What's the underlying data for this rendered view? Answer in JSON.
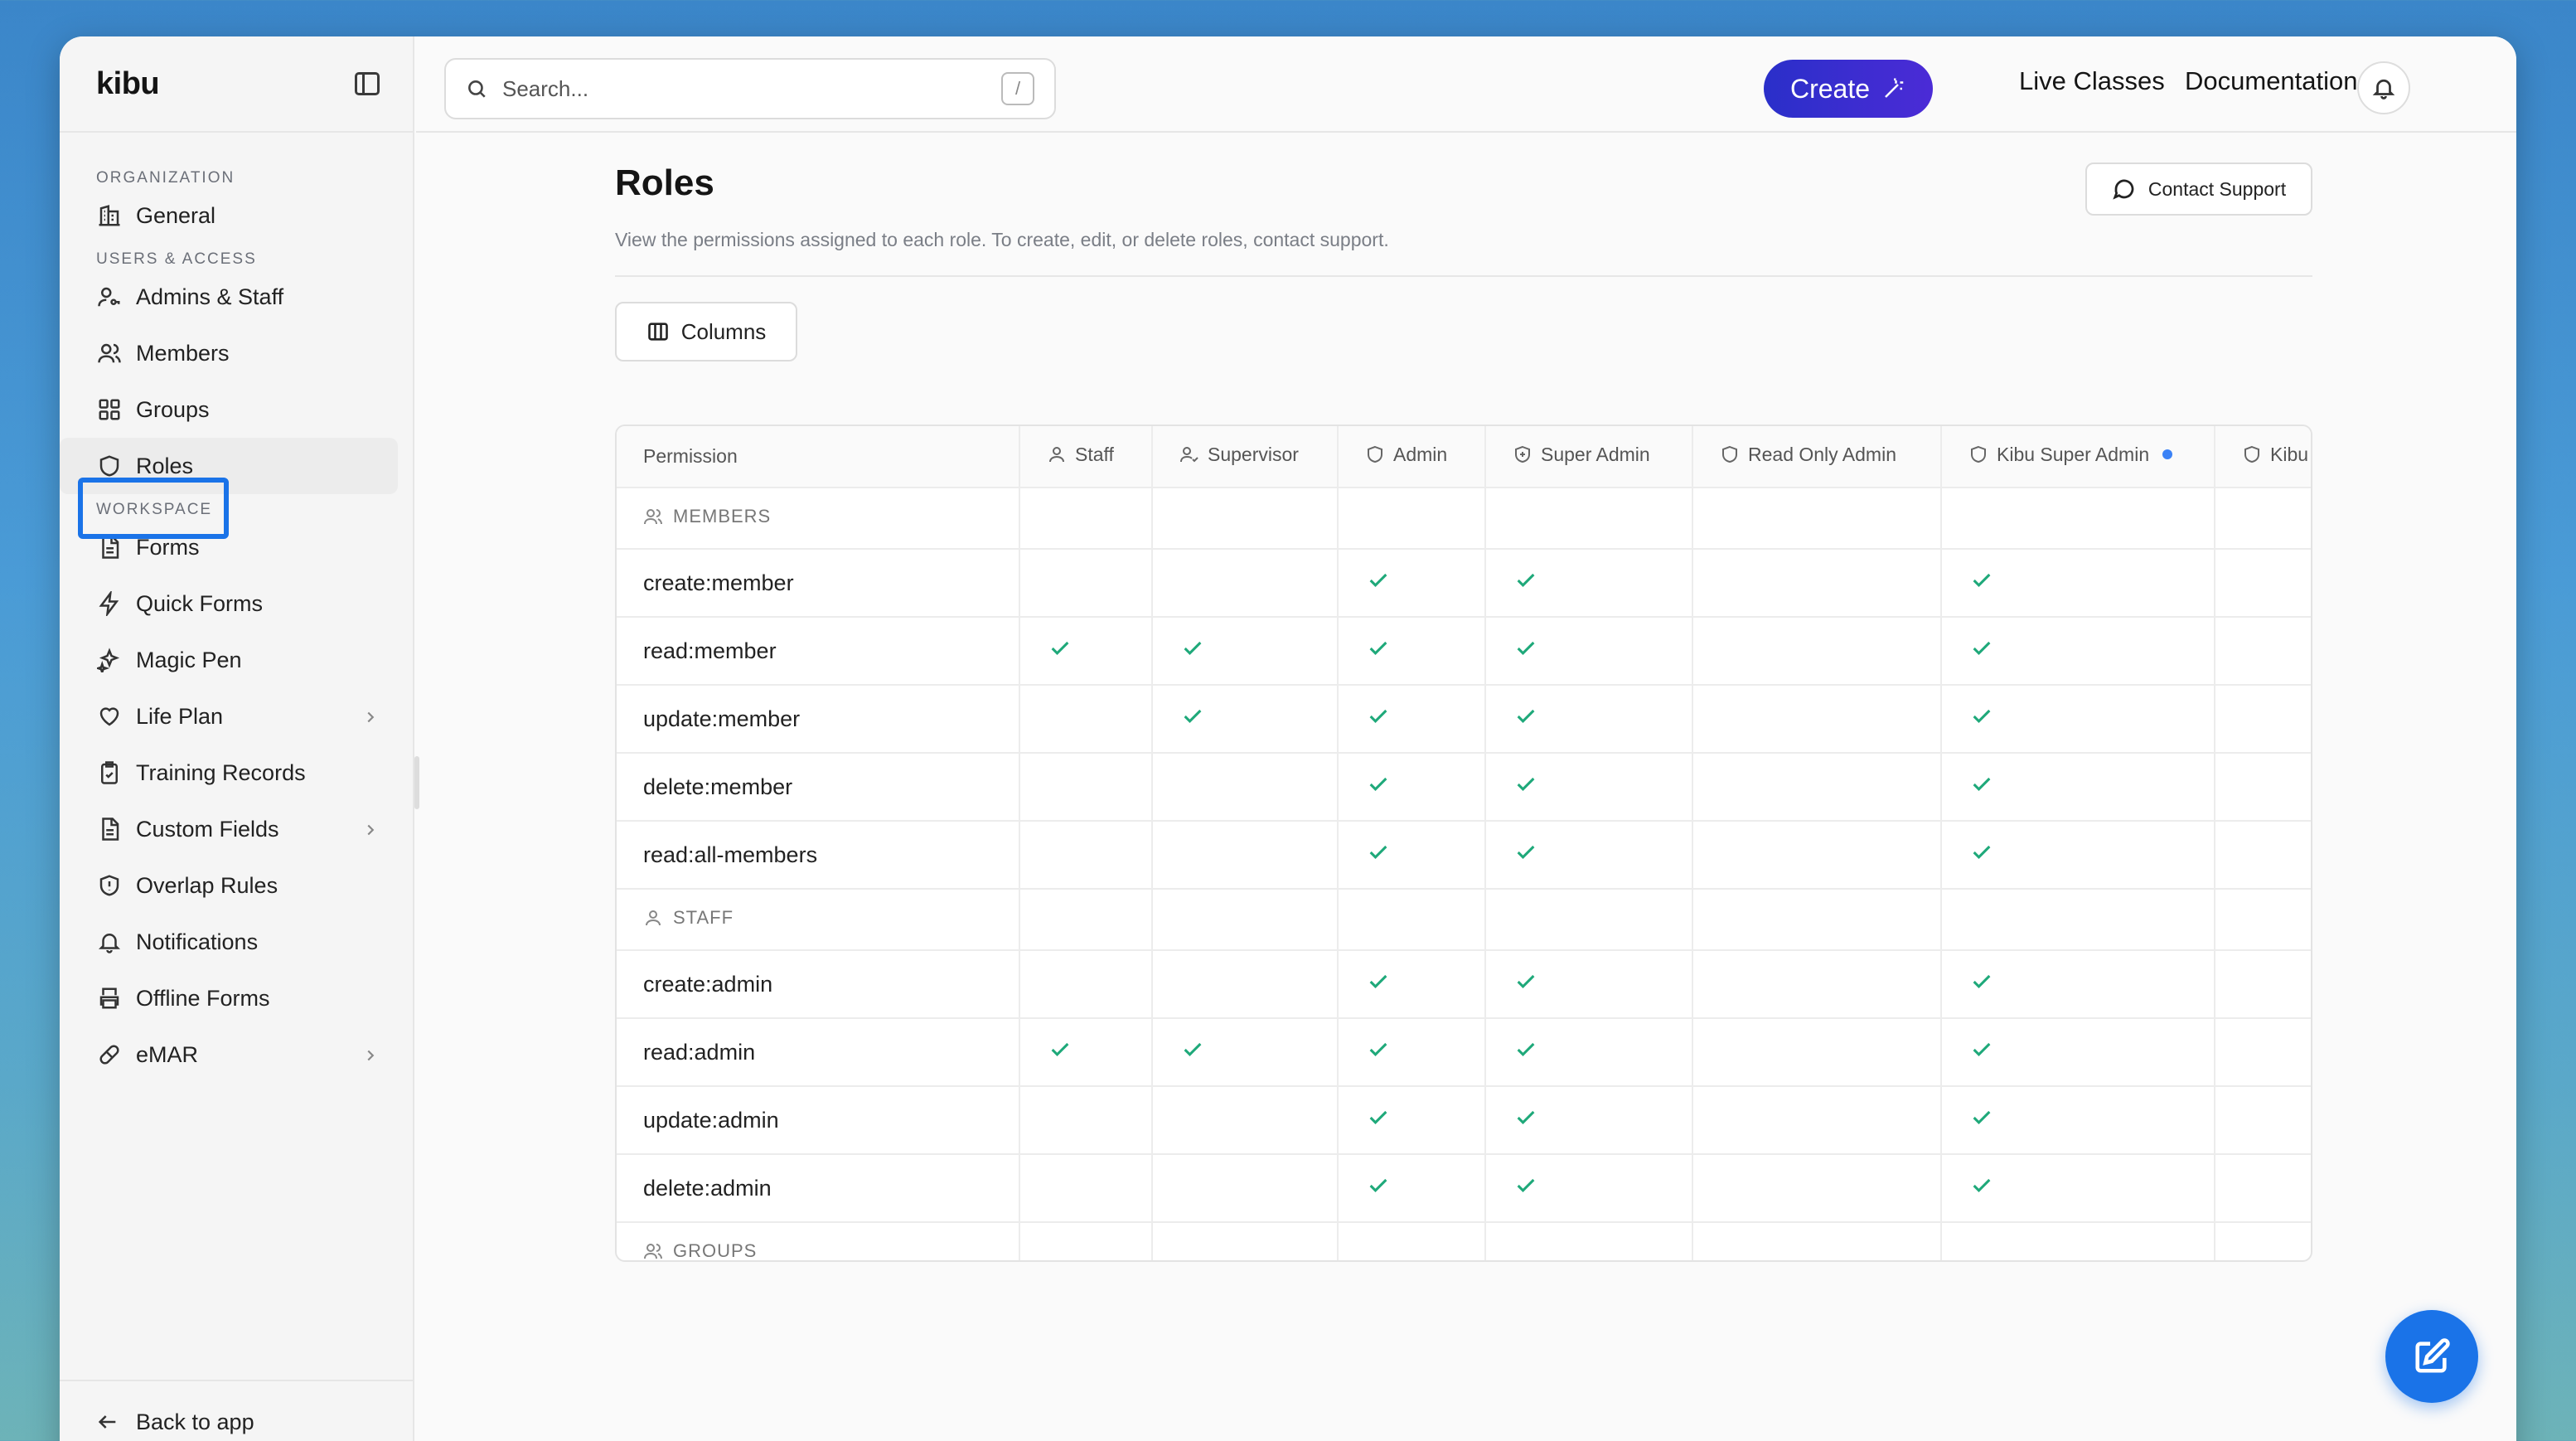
{
  "app": {
    "logo": "kibu"
  },
  "sidebar": {
    "sections": [
      {
        "label": "ORGANIZATION",
        "items": [
          {
            "label": "General",
            "icon": "building-icon"
          }
        ]
      },
      {
        "label": "USERS & ACCESS",
        "items": [
          {
            "label": "Admins & Staff",
            "icon": "user-key-icon"
          },
          {
            "label": "Members",
            "icon": "users-icon"
          },
          {
            "label": "Groups",
            "icon": "grid-icon"
          },
          {
            "label": "Roles",
            "icon": "shield-icon",
            "active": true
          }
        ]
      },
      {
        "label": "WORKSPACE",
        "items": [
          {
            "label": "Forms",
            "icon": "document-icon"
          },
          {
            "label": "Quick Forms",
            "icon": "lightning-icon"
          },
          {
            "label": "Magic Pen",
            "icon": "sparkles-icon"
          },
          {
            "label": "Life Plan",
            "icon": "heart-icon",
            "chevron": true
          },
          {
            "label": "Training Records",
            "icon": "clipboard-check-icon"
          },
          {
            "label": "Custom Fields",
            "icon": "document-icon",
            "chevron": true
          },
          {
            "label": "Overlap Rules",
            "icon": "shield-alert-icon"
          },
          {
            "label": "Notifications",
            "icon": "bell-icon"
          },
          {
            "label": "Offline Forms",
            "icon": "printer-icon"
          },
          {
            "label": "eMAR",
            "icon": "pill-icon",
            "chevron": true
          }
        ]
      }
    ],
    "footer": "Back to app"
  },
  "header": {
    "search_placeholder": "Search...",
    "search_shortcut": "/",
    "create_label": "Create",
    "links": [
      "Live Classes",
      "Documentation"
    ]
  },
  "page": {
    "title": "Roles",
    "subtitle": "View the permissions assigned to each role. To create, edit, or delete roles, contact support.",
    "support_label": "Contact Support",
    "columns_label": "Columns"
  },
  "table": {
    "first_header": "Permission",
    "roles": [
      "Staff",
      "Supervisor",
      "Admin",
      "Super Admin",
      "Read Only Admin",
      "Kibu Super Admin",
      "Kibu"
    ],
    "groups": [
      {
        "label": "MEMBERS",
        "rows": [
          {
            "permission": "create:member",
            "grants": [
              false,
              false,
              true,
              true,
              false,
              true,
              false
            ]
          },
          {
            "permission": "read:member",
            "grants": [
              true,
              true,
              true,
              true,
              false,
              true,
              false
            ]
          },
          {
            "permission": "update:member",
            "grants": [
              false,
              true,
              true,
              true,
              false,
              true,
              false
            ]
          },
          {
            "permission": "delete:member",
            "grants": [
              false,
              false,
              true,
              true,
              false,
              true,
              false
            ]
          },
          {
            "permission": "read:all-members",
            "grants": [
              false,
              false,
              true,
              true,
              false,
              true,
              false
            ]
          }
        ]
      },
      {
        "label": "STAFF",
        "rows": [
          {
            "permission": "create:admin",
            "grants": [
              false,
              false,
              true,
              true,
              false,
              true,
              false
            ]
          },
          {
            "permission": "read:admin",
            "grants": [
              true,
              true,
              true,
              true,
              false,
              true,
              false
            ]
          },
          {
            "permission": "update:admin",
            "grants": [
              false,
              false,
              true,
              true,
              false,
              true,
              false
            ]
          },
          {
            "permission": "delete:admin",
            "grants": [
              false,
              false,
              true,
              true,
              false,
              true,
              false
            ]
          }
        ]
      },
      {
        "label": "GROUPS",
        "rows": []
      }
    ]
  }
}
